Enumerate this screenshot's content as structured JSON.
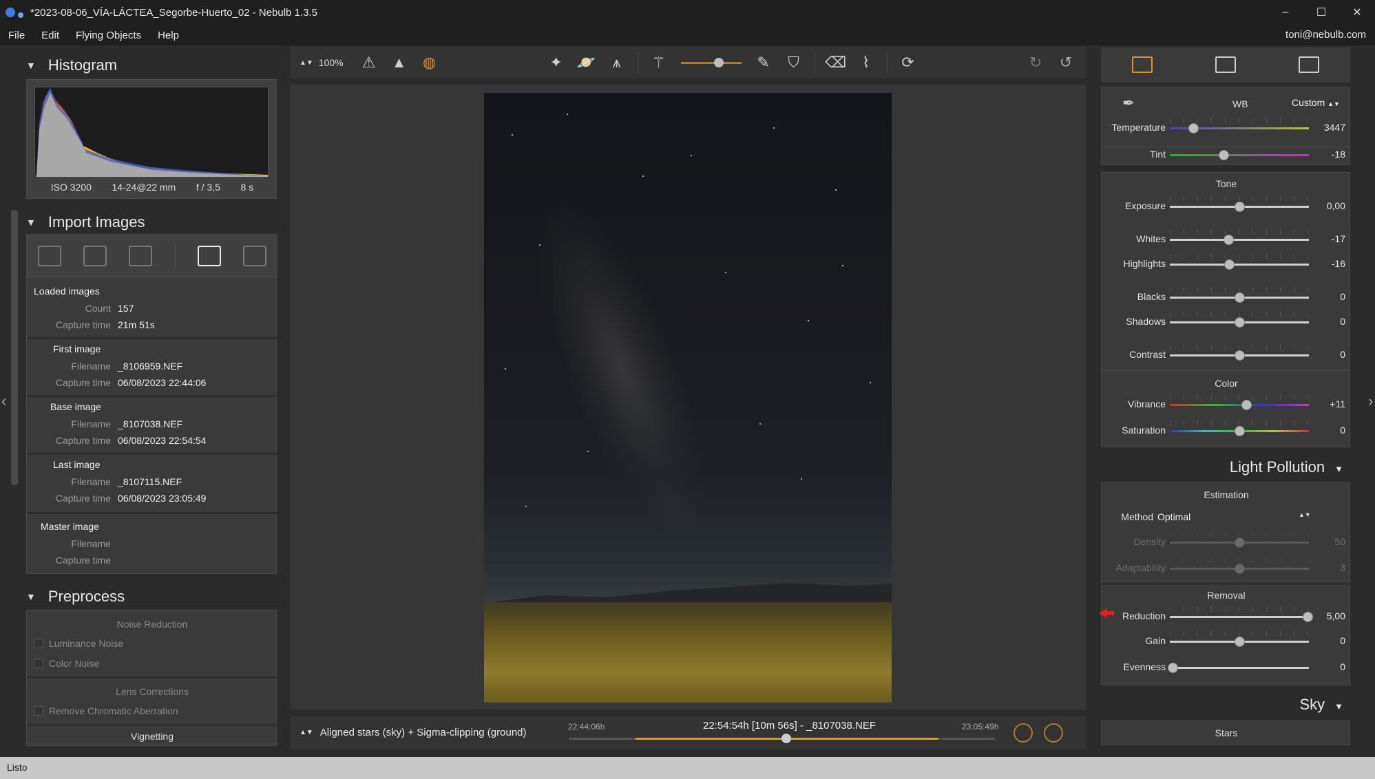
{
  "window": {
    "title": "*2023-08-06_VÍA-LÁCTEA_Segorbe-Huerto_02 - Nebulb 1.3.5",
    "minimize": "–",
    "maximize": "☐",
    "close": "✕"
  },
  "menu": {
    "items": [
      "File",
      "Edit",
      "Flying Objects",
      "Help"
    ],
    "user": "toni@nebulb.com"
  },
  "histogram": {
    "title": "Histogram",
    "iso": "ISO 3200",
    "lens": "14-24@22 mm",
    "aperture": "f / 3,5",
    "shutter": "8 s"
  },
  "import": {
    "title": "Import Images",
    "loaded_title": "Loaded images",
    "count_label": "Count",
    "count": "157",
    "capture_label": "Capture time",
    "capture": "21m 51s",
    "first_title": "First image",
    "filename_label": "Filename",
    "first_filename": "_8106959.NEF",
    "first_capture": "06/08/2023 22:44:06",
    "base_title": "Base image",
    "base_filename": "_8107038.NEF",
    "base_capture": "06/08/2023 22:54:54",
    "last_title": "Last image",
    "last_filename": "_8107115.NEF",
    "last_capture": "06/08/2023 23:05:49",
    "master_title": "Master image"
  },
  "preprocess": {
    "title": "Preprocess",
    "noise_title": "Noise Reduction",
    "luminance": "Luminance Noise",
    "color": "Color Noise",
    "lens_title": "Lens Corrections",
    "chromatic": "Remove Chromatic Aberration",
    "vignetting": "Vignetting"
  },
  "toolbar": {
    "zoom": "100%"
  },
  "bottom": {
    "method": "Aligned stars (sky) + Sigma-clipping (ground)",
    "start": "22:44:06h",
    "end": "23:05:49h",
    "current": "22:54:54h [10m 56s] - _8107038.NEF"
  },
  "wb": {
    "label": "WB",
    "mode": "Custom",
    "temperature_label": "Temperature",
    "temperature": "3447",
    "tint_label": "Tint",
    "tint": "-18"
  },
  "tone": {
    "title": "Tone",
    "exposure_label": "Exposure",
    "exposure": "0,00",
    "whites_label": "Whites",
    "whites": "-17",
    "highlights_label": "Highlights",
    "highlights": "-16",
    "blacks_label": "Blacks",
    "blacks": "0",
    "shadows_label": "Shadows",
    "shadows": "0",
    "contrast_label": "Contrast",
    "contrast": "0"
  },
  "color": {
    "title": "Color",
    "vibrance_label": "Vibrance",
    "vibrance": "+11",
    "saturation_label": "Saturation",
    "saturation": "0"
  },
  "light_pollution": {
    "title": "Light Pollution",
    "estimation_title": "Estimation",
    "method_label": "Method",
    "method": "Optimal",
    "density_label": "Density",
    "density": "50",
    "adaptability_label": "Adaptability",
    "adaptability": "3",
    "removal_title": "Removal",
    "reduction_label": "Reduction",
    "reduction": "5,00",
    "gain_label": "Gain",
    "gain": "0",
    "evenness_label": "Evenness",
    "evenness": "0"
  },
  "sky": {
    "title": "Sky",
    "stars": "Stars"
  },
  "status": {
    "text": "Listo"
  }
}
